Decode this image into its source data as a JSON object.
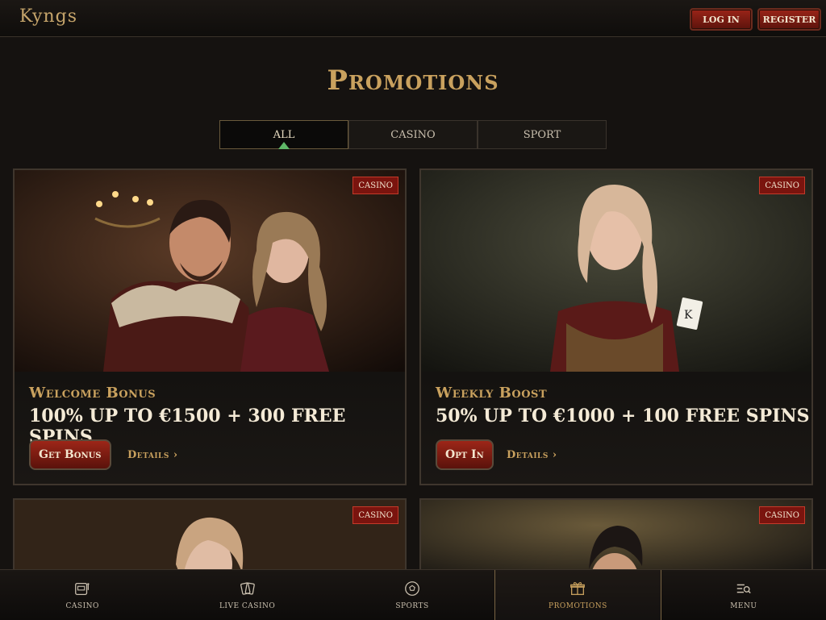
{
  "header": {
    "logo_text": "Kyngs",
    "login_label": "LOG IN",
    "register_label": "REGISTER"
  },
  "page_title": "Promotions",
  "tabs": [
    {
      "label": "ALL",
      "active": true
    },
    {
      "label": "CASINO",
      "active": false
    },
    {
      "label": "SPORT",
      "active": false
    }
  ],
  "promotions": [
    {
      "badge": "CASINO",
      "subtitle": "Welcome Bonus",
      "title": "100% UP TO €1500 + 300 FREE SPINS",
      "cta": "Get Bonus",
      "details": "Details ›"
    },
    {
      "badge": "CASINO",
      "subtitle": "Weekly Boost",
      "title": "50% UP TO €1000 + 100 FREE SPINS",
      "cta": "Opt In",
      "details": "Details ›"
    },
    {
      "badge": "CASINO"
    },
    {
      "badge": "CASINO"
    }
  ],
  "bottom_nav": [
    {
      "label": "CASINO",
      "icon": "slot-machine-icon"
    },
    {
      "label": "LIVE CASINO",
      "icon": "cards-icon"
    },
    {
      "label": "SPORTS",
      "icon": "soccer-ball-icon"
    },
    {
      "label": "PROMOTIONS",
      "icon": "gift-icon",
      "active": true
    },
    {
      "label": "MENU",
      "icon": "menu-search-icon"
    }
  ],
  "colors": {
    "accent_gold": "#c9a15e",
    "button_red": "#9a2418",
    "badge_red": "#7a140e",
    "background": "#151210"
  }
}
